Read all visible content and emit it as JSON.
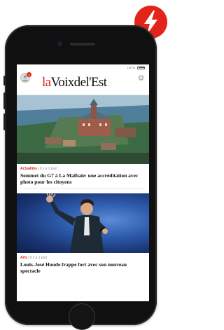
{
  "status_bar": {
    "battery": "100 %"
  },
  "header": {
    "logo_prefix": "la",
    "logo_main": "Voixdel'Est",
    "profile_badge_count": "1"
  },
  "articles": [
    {
      "category": "Actualités",
      "time": "| il y a 1 jour",
      "headline": "Sommet du G7 à La Malbaie: une accréditation avec photo pour les citoyens"
    },
    {
      "category": "Arts",
      "time": "| il y a 1 jour",
      "headline": "Louis-José Houde frappe fort avec son nouveau spectacle"
    }
  ],
  "icons": {
    "flash": "lightning-bolt-icon",
    "settings": "gear-icon",
    "profile": "profile-icon"
  },
  "colors": {
    "accent_red": "#e2251a",
    "phone_body": "#101011"
  }
}
